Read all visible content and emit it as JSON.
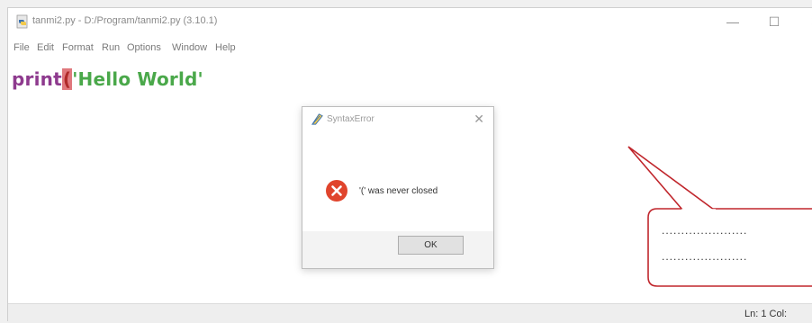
{
  "window": {
    "title": "tanmi2.py - D:/Program/tanmi2.py (3.10.1)",
    "minimize_glyph": "—",
    "maximize_glyph": "☐",
    "close_glyph": "✕"
  },
  "menubar": {
    "items": [
      "File",
      "Edit",
      "Format",
      "Run",
      "Options",
      "Window",
      "Help"
    ]
  },
  "editor": {
    "keyword": "print",
    "open_paren": "(",
    "string_literal": "'Hello World'"
  },
  "statusbar": {
    "position": "Ln: 1  Col:"
  },
  "dialog": {
    "title": "SyntaxError",
    "close_glyph": "✕",
    "message": "'(' was never closed",
    "ok_label": "OK",
    "icon": "error-icon"
  },
  "callout": {
    "line1": "......................",
    "line2": "......................"
  },
  "colors": {
    "keyword": "#8e3a8e",
    "string": "#4aa84a",
    "error_highlight": "#e0787d",
    "error_icon": "#e0442c",
    "callout_stroke": "#c0262c"
  }
}
